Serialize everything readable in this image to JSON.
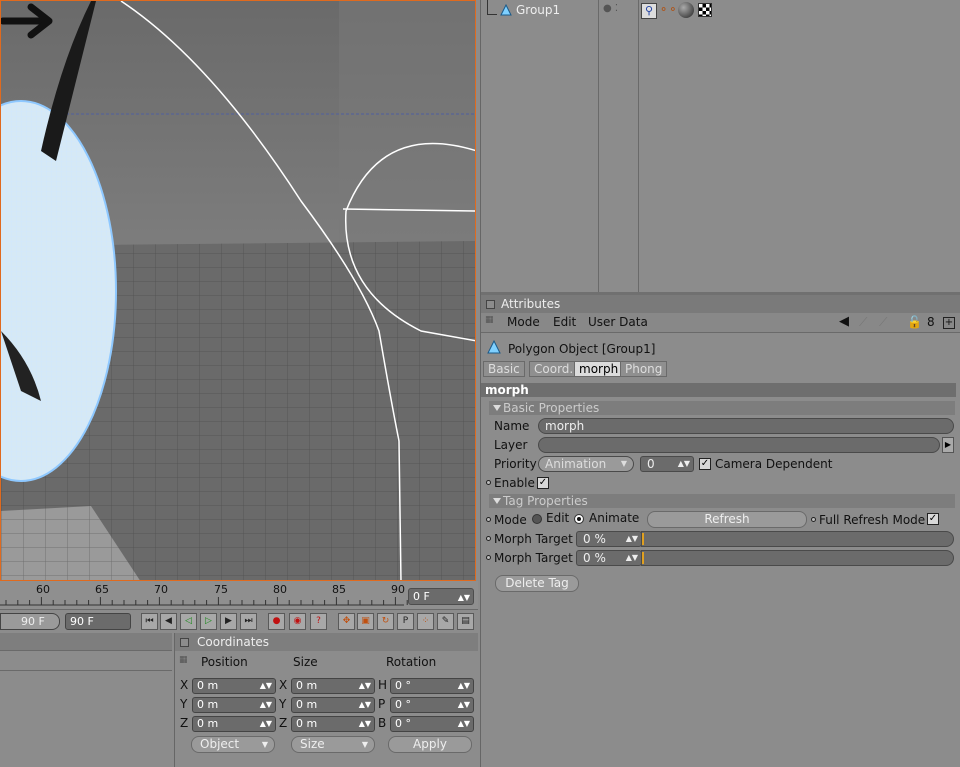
{
  "viewport": {
    "timeline_ticks": [
      "60",
      "65",
      "70",
      "75",
      "80",
      "85",
      "90"
    ],
    "current_frame": "0 F"
  },
  "transport": {
    "end_frame_slider": "90 F",
    "end_frame_field": "90 F"
  },
  "object_manager": {
    "object_name": "Group1"
  },
  "coordinates": {
    "title": "Coordinates",
    "col_position": "Position",
    "col_size": "Size",
    "col_rotation": "Rotation",
    "rows": [
      {
        "pos_label": "X",
        "pos_value": "0 m",
        "size_label": "X",
        "size_value": "0 m",
        "rot_label": "H",
        "rot_value": "0 °"
      },
      {
        "pos_label": "Y",
        "pos_value": "0 m",
        "size_label": "Y",
        "size_value": "0 m",
        "rot_label": "P",
        "rot_value": "0 °"
      },
      {
        "pos_label": "Z",
        "pos_value": "0 m",
        "size_label": "Z",
        "size_value": "0 m",
        "rot_label": "B",
        "rot_value": "0 °"
      }
    ],
    "mode_select": "Object",
    "size_select": "Size",
    "apply_label": "Apply"
  },
  "attributes": {
    "title": "Attributes",
    "menu": [
      "Mode",
      "Edit",
      "User Data"
    ],
    "object_heading": "Polygon Object [Group1]",
    "tabs": [
      "Basic",
      "Coord.",
      "morph",
      "Phong"
    ],
    "active_tab": "morph",
    "section_title": "morph",
    "basic_group": "Basic Properties",
    "name_label": "Name",
    "name_value": "morph",
    "layer_label": "Layer",
    "priority_label": "Priority",
    "priority_value": "Animation",
    "priority_number": "0",
    "camera_dependent_label": "Camera Dependent",
    "enable_label": "Enable",
    "tag_group": "Tag Properties",
    "mode_label": "Mode",
    "mode_edit": "Edit",
    "mode_animate": "Animate",
    "refresh_label": "Refresh",
    "full_refresh_label": "Full Refresh Mode",
    "morph_targets": [
      {
        "label": "Morph Target",
        "value": "0 %"
      },
      {
        "label": "Morph Target",
        "value": "0 %"
      }
    ],
    "delete_tag_label": "Delete Tag"
  },
  "colors": {
    "accent_orange": "#e06a1e",
    "mesh_blue": "#8ec8ff",
    "panel_gray": "#8c8c8c"
  }
}
